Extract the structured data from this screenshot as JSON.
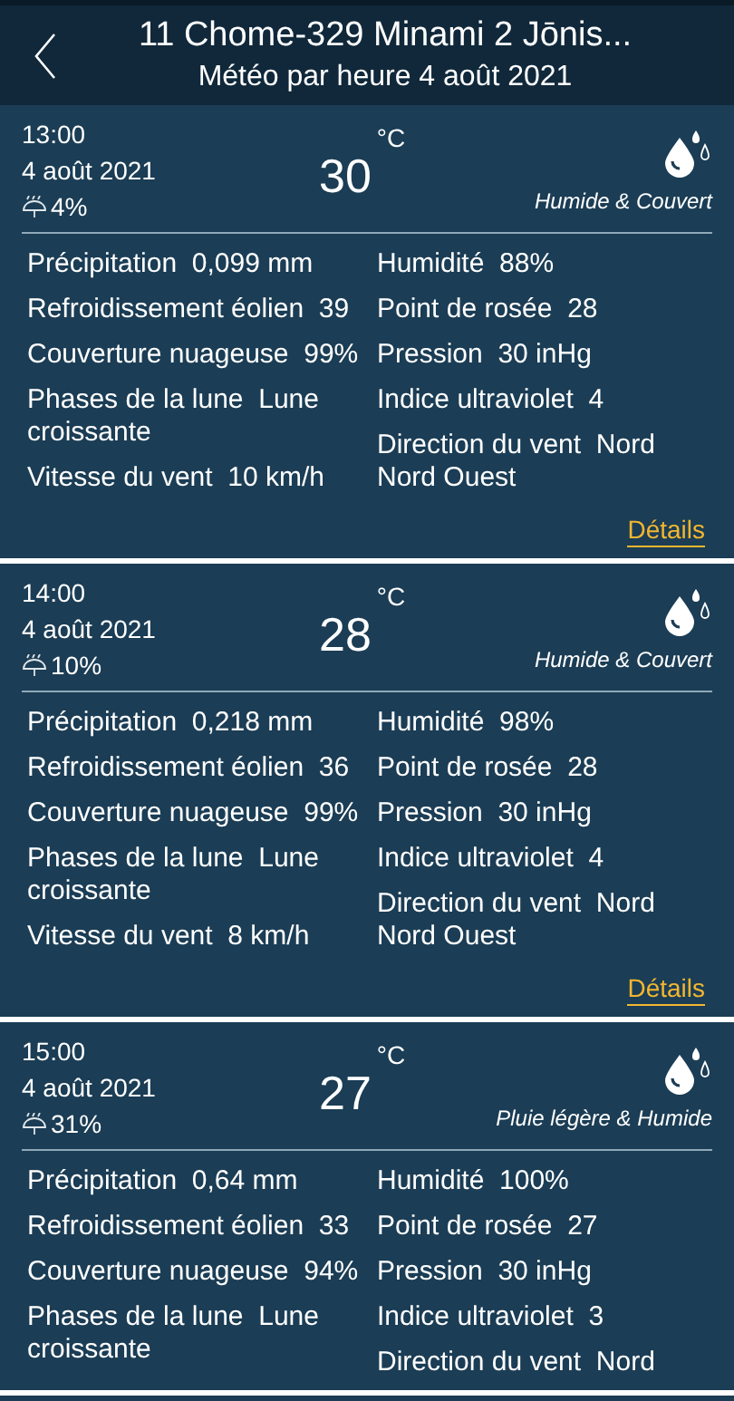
{
  "header": {
    "title": "11 Chome-329 Minami 2 Jōnis...",
    "subtitle": "Météo par heure 4 août 2021"
  },
  "cards": [
    {
      "time": "13:00",
      "date": "4 août 2021",
      "rain_chance": "4%",
      "temperature": "30",
      "unit": "°C",
      "condition": "Humide & Couvert",
      "left": [
        {
          "label": "Précipitation",
          "value": "0,099 mm"
        },
        {
          "label": "Refroidissement éolien",
          "value": "39"
        },
        {
          "label": "Couverture nuageuse",
          "value": "99%"
        },
        {
          "label": "Phases de la lune",
          "value": "Lune croissante"
        },
        {
          "label": "Vitesse du vent",
          "value": "10 km/h"
        }
      ],
      "right": [
        {
          "label": "Humidité",
          "value": "88%"
        },
        {
          "label": "Point de rosée",
          "value": "28"
        },
        {
          "label": "Pression",
          "value": "30 inHg"
        },
        {
          "label": "Indice ultraviolet",
          "value": "4"
        },
        {
          "label": "Direction du vent",
          "value": "Nord Nord Ouest"
        }
      ],
      "link": "Détails"
    },
    {
      "time": "14:00",
      "date": "4 août 2021",
      "rain_chance": "10%",
      "temperature": "28",
      "unit": "°C",
      "condition": "Humide & Couvert",
      "left": [
        {
          "label": "Précipitation",
          "value": "0,218 mm"
        },
        {
          "label": "Refroidissement éolien",
          "value": "36"
        },
        {
          "label": "Couverture nuageuse",
          "value": "99%"
        },
        {
          "label": "Phases de la lune",
          "value": "Lune croissante"
        },
        {
          "label": "Vitesse du vent",
          "value": "8 km/h"
        }
      ],
      "right": [
        {
          "label": "Humidité",
          "value": "98%"
        },
        {
          "label": "Point de rosée",
          "value": "28"
        },
        {
          "label": "Pression",
          "value": "30 inHg"
        },
        {
          "label": "Indice ultraviolet",
          "value": "4"
        },
        {
          "label": "Direction du vent",
          "value": "Nord Nord Ouest"
        }
      ],
      "link": "Détails"
    },
    {
      "time": "15:00",
      "date": "4 août 2021",
      "rain_chance": "31%",
      "temperature": "27",
      "unit": "°C",
      "condition": "Pluie légère & Humide",
      "left": [
        {
          "label": "Précipitation",
          "value": "0,64 mm"
        },
        {
          "label": "Refroidissement éolien",
          "value": "33"
        },
        {
          "label": "Couverture nuageuse",
          "value": "94%"
        },
        {
          "label": "Phases de la lune",
          "value": "Lune croissante"
        }
      ],
      "right": [
        {
          "label": "Humidité",
          "value": "100%"
        },
        {
          "label": "Point de rosée",
          "value": "27"
        },
        {
          "label": "Pression",
          "value": "30 inHg"
        },
        {
          "label": "Indice ultraviolet",
          "value": "3"
        },
        {
          "label": "Direction du vent",
          "value": "Nord"
        }
      ]
    }
  ]
}
